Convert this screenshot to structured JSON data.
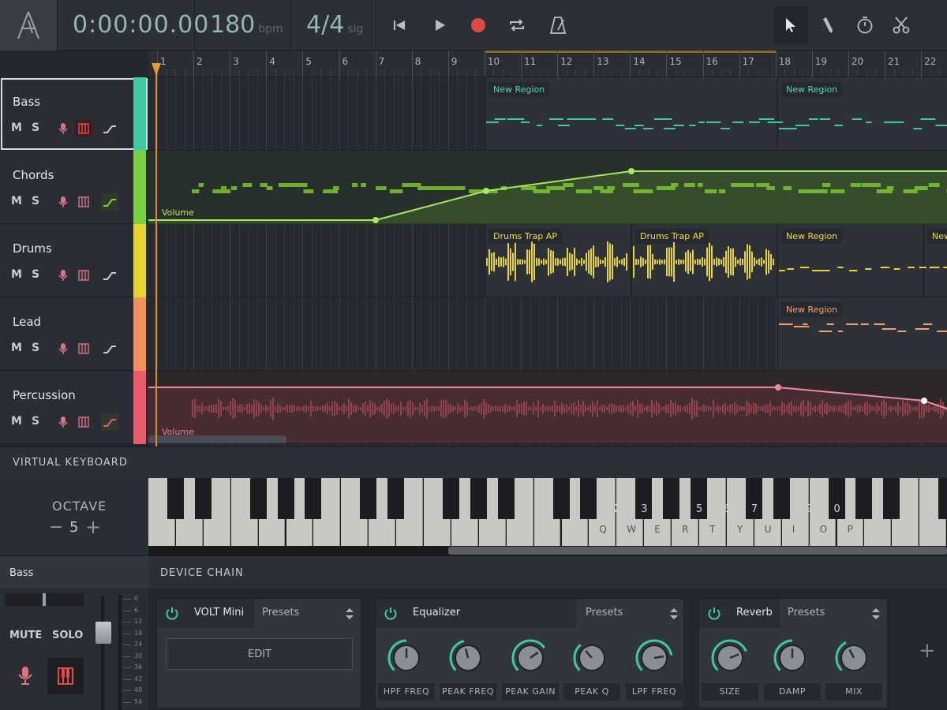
{
  "transport": {
    "time": "0:00:00.00",
    "tempo": "180",
    "tempo_unit": "bpm",
    "signature": "4/4",
    "signature_unit": "sig"
  },
  "ruler": {
    "bars": [
      "1",
      "2",
      "3",
      "4",
      "5",
      "6",
      "7",
      "8",
      "9",
      "10",
      "11",
      "12",
      "13",
      "14",
      "15",
      "16",
      "17",
      "18",
      "19",
      "20",
      "21",
      "22"
    ],
    "loop_start_bar": 10,
    "loop_end_bar": 18
  },
  "tracks": [
    {
      "name": "Bass",
      "mute": "M",
      "solo": "S",
      "color": "#3fc9a0",
      "selected": true,
      "piano_on": true,
      "auto_on": false
    },
    {
      "name": "Chords",
      "mute": "M",
      "solo": "S",
      "color": "#7ad13f",
      "selected": false,
      "piano_on": false,
      "auto_on": true
    },
    {
      "name": "Drums",
      "mute": "M",
      "solo": "S",
      "color": "#e8d42e",
      "selected": false,
      "piano_on": false,
      "auto_on": false
    },
    {
      "name": "Lead",
      "mute": "M",
      "solo": "S",
      "color": "#f0905a",
      "selected": false,
      "piano_on": false,
      "auto_on": false
    },
    {
      "name": "Percussion",
      "mute": "M",
      "solo": "S",
      "color": "#ec5a6e",
      "selected": false,
      "piano_on": false,
      "auto_on": true
    }
  ],
  "regions": {
    "bass": [
      "New Region",
      "New Region"
    ],
    "drums": [
      "Drums Trap AP",
      "Drums Trap AP",
      "New Region",
      "New"
    ],
    "lead": [
      "New Region"
    ]
  },
  "automation": {
    "chords_label": "Volume",
    "percussion_label": "Volume"
  },
  "keyboard": {
    "title": "VIRTUAL KEYBOARD",
    "octave_label": "OCTAVE",
    "octave_value": "5",
    "minus": "−",
    "plus": "+",
    "white_labels": [
      "Q",
      "W",
      "E",
      "R",
      "T",
      "Y",
      "U",
      "I",
      "O",
      "P"
    ],
    "black_labels": [
      "2",
      "3",
      "5",
      "6",
      "7",
      "9",
      "0"
    ]
  },
  "bottom": {
    "selected_track": "Bass",
    "device_chain_title": "DEVICE CHAIN",
    "mute": "MUTE",
    "solo": "SOLO",
    "meter_scale": [
      "0",
      "6",
      "12",
      "18",
      "24",
      "30",
      "36",
      "42",
      "48",
      "54"
    ],
    "add": "+"
  },
  "devices": [
    {
      "name": "VOLT Mini",
      "presets": "Presets",
      "edit": "EDIT"
    },
    {
      "name": "Equalizer",
      "presets": "Presets",
      "knobs": [
        "HPF FREQ",
        "PEAK FREQ",
        "PEAK GAIN",
        "PEAK Q",
        "LPF FREQ"
      ],
      "levels": [
        0.5,
        0.45,
        0.7,
        0.35,
        0.8
      ]
    },
    {
      "name": "Reverb",
      "presets": "Presets",
      "knobs": [
        "SIZE",
        "DAMP",
        "MIX"
      ],
      "levels": [
        0.75,
        0.5,
        0.4
      ]
    }
  ],
  "colors": {
    "accent": "#3fc9a0",
    "record": "#e04848",
    "power": "#3fc9a0",
    "playhead": "#e89b32"
  }
}
